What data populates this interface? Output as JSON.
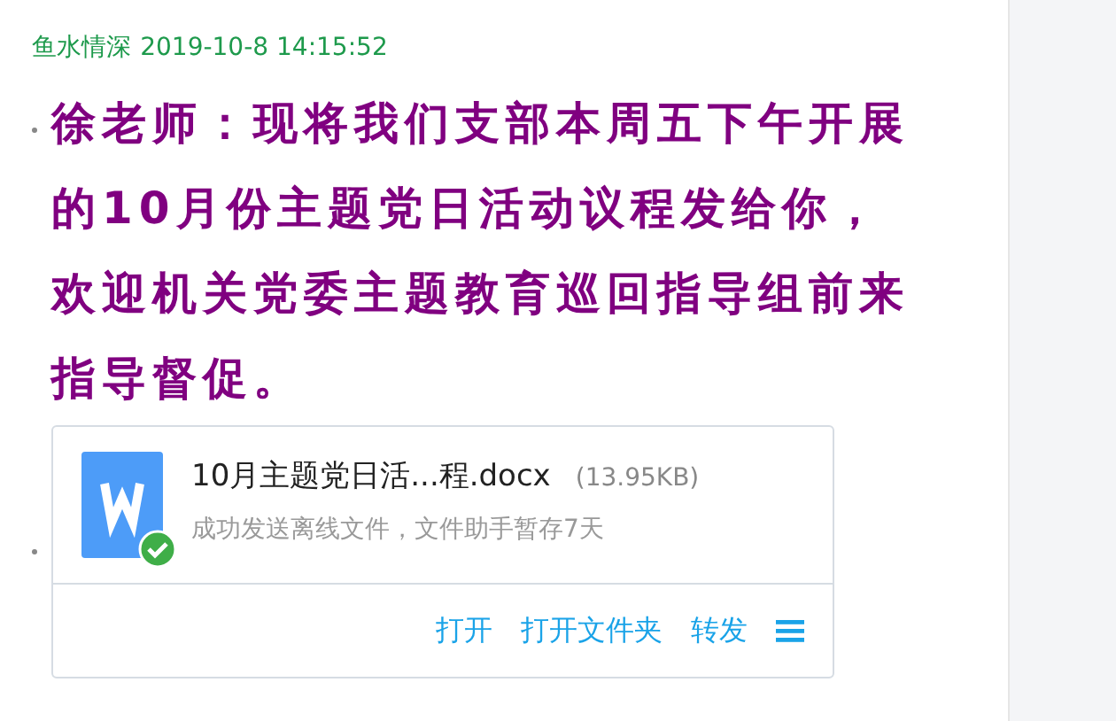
{
  "message": {
    "sender": "鱼水情深",
    "time": "2019-10-8 14:15:52",
    "text": "徐老师：现将我们支部本周五下午开展的10月份主题党日活动议程发给你，欢迎机关党委主题教育巡回指导组前来指导督促。"
  },
  "file": {
    "name": "10月主题党日活...程.docx",
    "size": "(13.95KB)",
    "status": "成功发送离线文件，文件助手暂存7天",
    "sent": true,
    "actions": [
      "打开",
      "打开文件夹",
      "转发"
    ]
  }
}
